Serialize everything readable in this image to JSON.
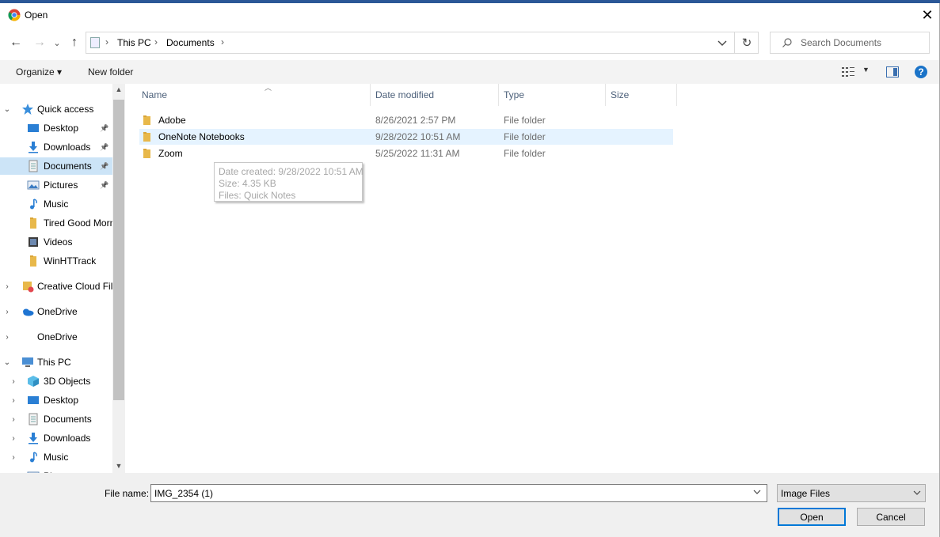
{
  "window": {
    "title": "Open",
    "close_glyph": "✕"
  },
  "nav": {
    "back_glyph": "←",
    "forward_glyph": "→",
    "recent_glyph": "⌄",
    "up_glyph": "↑",
    "refresh_glyph": "↻",
    "breadcrumb": [
      "This PC",
      "Documents"
    ],
    "separator": "›",
    "search_placeholder": "Search Documents"
  },
  "toolbar": {
    "organize_label": "Organize ▾",
    "new_folder_label": "New folder",
    "help_glyph": "?"
  },
  "sidebar": {
    "items": [
      {
        "label": "Quick access",
        "icon": "star-icon",
        "pinned": false
      },
      {
        "label": "Desktop",
        "icon": "desktop-icon",
        "pinned": true
      },
      {
        "label": "Downloads",
        "icon": "download-icon",
        "pinned": true
      },
      {
        "label": "Documents",
        "icon": "document-icon",
        "pinned": true,
        "selected": true
      },
      {
        "label": "Pictures",
        "icon": "pictures-icon",
        "pinned": true
      },
      {
        "label": "Music",
        "icon": "music-icon",
        "pinned": false
      },
      {
        "label": "Tired Good Morn",
        "icon": "folder-icon",
        "pinned": false
      },
      {
        "label": "Videos",
        "icon": "videos-icon",
        "pinned": false
      },
      {
        "label": "WinHTTrack",
        "icon": "folder-icon",
        "pinned": false
      },
      {
        "label": "Creative Cloud Fil",
        "icon": "creative-cloud-icon",
        "pinned": false
      },
      {
        "label": "OneDrive",
        "icon": "onedrive-icon",
        "pinned": false
      },
      {
        "label": "OneDrive",
        "icon": "none",
        "pinned": false
      },
      {
        "label": "This PC",
        "icon": "computer-icon",
        "pinned": false
      },
      {
        "label": "3D Objects",
        "icon": "3d-objects-icon",
        "pinned": false
      },
      {
        "label": "Desktop",
        "icon": "desktop-icon",
        "pinned": false
      },
      {
        "label": "Documents",
        "icon": "document-icon",
        "pinned": false
      },
      {
        "label": "Downloads",
        "icon": "download-icon",
        "pinned": false
      },
      {
        "label": "Music",
        "icon": "music-icon",
        "pinned": false
      },
      {
        "label": "Pictures",
        "icon": "pictures-icon",
        "pinned": false
      }
    ]
  },
  "files": {
    "columns": [
      "Name",
      "Date modified",
      "Type",
      "Size"
    ],
    "rows": [
      {
        "name": "Adobe",
        "date": "8/26/2021 2:57 PM",
        "type": "File folder"
      },
      {
        "name": "OneNote Notebooks",
        "date": "9/28/2022 10:51 AM",
        "type": "File folder"
      },
      {
        "name": "Zoom",
        "date": "5/25/2022 11:31 AM",
        "type": "File folder"
      }
    ]
  },
  "tooltip": {
    "line1": "Date created: 9/28/2022 10:51 AM",
    "line2": "Size: 4.35 KB",
    "line3": "Files: Quick Notes"
  },
  "bottom": {
    "file_name_label": "File name:",
    "file_name_value": "IMG_2354 (1)",
    "file_type_value": "Image Files",
    "open_label": "Open",
    "cancel_label": "Cancel"
  },
  "colors": {
    "accent": "#0078d7",
    "selection": "#cce4f7",
    "hover": "#e5f3ff",
    "folder": "#e8b84a"
  }
}
